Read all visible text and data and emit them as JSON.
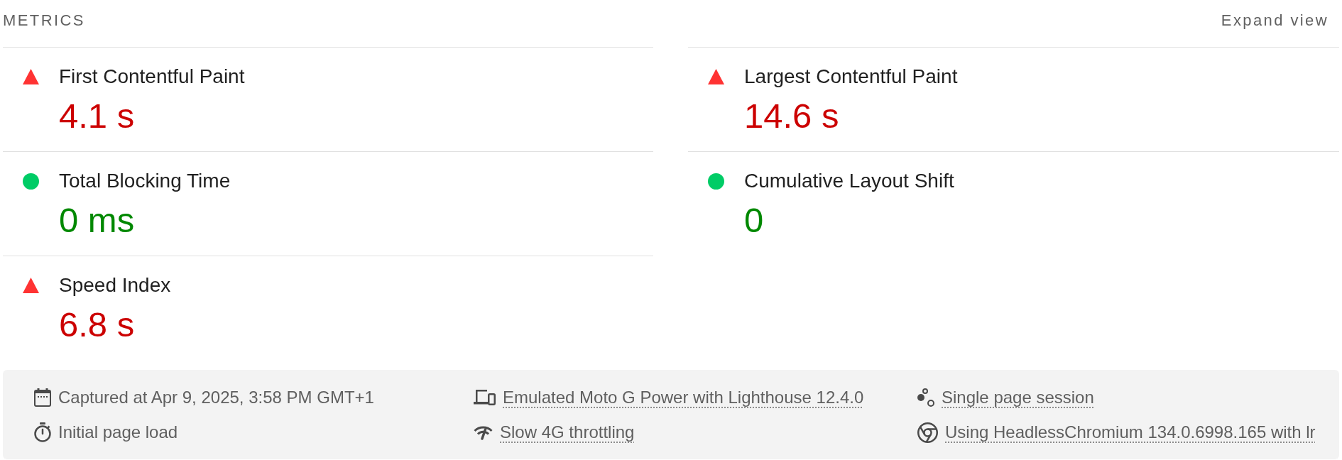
{
  "header": {
    "title": "METRICS",
    "expand_button": "Expand view"
  },
  "metrics": [
    {
      "name": "First Contentful Paint",
      "value": "4.1 s",
      "kind": "fail"
    },
    {
      "name": "Largest Contentful Paint",
      "value": "14.6 s",
      "kind": "fail"
    },
    {
      "name": "Total Blocking Time",
      "value": "0 ms",
      "kind": "pass"
    },
    {
      "name": "Cumulative Layout Shift",
      "value": "0",
      "kind": "pass"
    },
    {
      "name": "Speed Index",
      "value": "6.8 s",
      "kind": "fail"
    }
  ],
  "footer": {
    "items": [
      {
        "kind": "timestamp",
        "text": "Captured at Apr 9, 2025, 3:58 PM GMT+1",
        "link": false
      },
      {
        "kind": "device",
        "text": "Emulated Moto G Power with Lighthouse 12.4.0",
        "link": true
      },
      {
        "kind": "session",
        "text": "Single page session",
        "link": true
      },
      {
        "kind": "load",
        "text": "Initial page load",
        "link": false
      },
      {
        "kind": "network",
        "text": "Slow 4G throttling",
        "link": true
      },
      {
        "kind": "browser",
        "text": "Using HeadlessChromium 134.0.6998.165 with lr",
        "link": true
      }
    ]
  }
}
